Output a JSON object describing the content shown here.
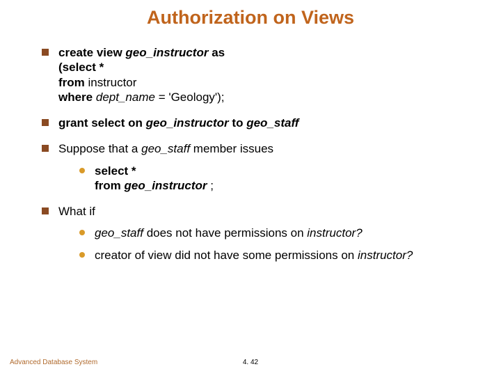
{
  "title": "Authorization on Views",
  "bullets": {
    "b1": {
      "l1": "create view",
      "l1i": "geo_instructor",
      "l1b": "as",
      "l2": "(select *",
      "l3": "from",
      "l3p": "instructor",
      "l4": "where",
      "l4i": "dept_name",
      "l4t": "= 'Geology');"
    },
    "b2": {
      "a": "grant select on",
      "b": "geo_instructor",
      "c": "to",
      "d": "geo_staff"
    },
    "b3": {
      "a": "Suppose that a",
      "b": "geo_staff",
      "c": "member issues",
      "sub": {
        "l1": "select *",
        "l2a": "from",
        "l2b": "geo_instructor",
        "l2c": ";"
      }
    },
    "b4": {
      "a": "What if",
      "s1": {
        "a": "geo_staff",
        "b": "does not have permissions on",
        "c": "instructor?"
      },
      "s2": {
        "a": "creator of view did not have some permissions on",
        "b": "instructor?"
      }
    }
  },
  "footer": {
    "left": "Advanced Database System",
    "center": "4. 42"
  }
}
